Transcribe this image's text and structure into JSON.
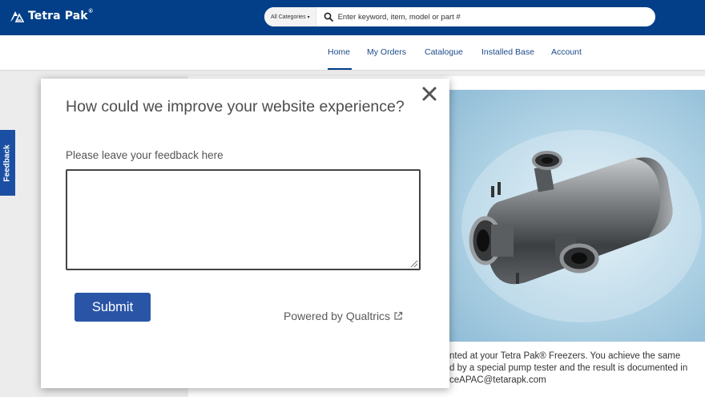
{
  "header": {
    "logo_text": "Tetra Pak",
    "logo_reg": "®",
    "category_label": "All Categories",
    "category_caret": "▾",
    "search_placeholder": "Enter keyword, item, model or part #"
  },
  "nav": {
    "items": [
      {
        "label": "Home",
        "active": true
      },
      {
        "label": "My Orders"
      },
      {
        "label": "Catalogue"
      },
      {
        "label": "Installed Base"
      },
      {
        "label": "Account"
      }
    ]
  },
  "feedback_tab": {
    "label": "Feedback"
  },
  "background": {
    "lines": [
      "nted at your Tetra Pak® Freezers. You achieve the same",
      "d by a special pump tester and the result is documented in",
      "ceAPAC@tetarapk.com"
    ]
  },
  "modal": {
    "title": "How could we improve your website experience?",
    "close_icon": "close-icon",
    "label": "Please leave your feedback here",
    "textarea_value": "",
    "submit_label": "Submit",
    "powered_by": "Powered by Qualtrics",
    "external_icon": "external-link-icon"
  },
  "colors": {
    "header_bg": "#023f88",
    "nav_text": "#1c4b8a",
    "submit_bg": "#2a55a6",
    "feedback_tab_bg": "#1b4fa3"
  }
}
